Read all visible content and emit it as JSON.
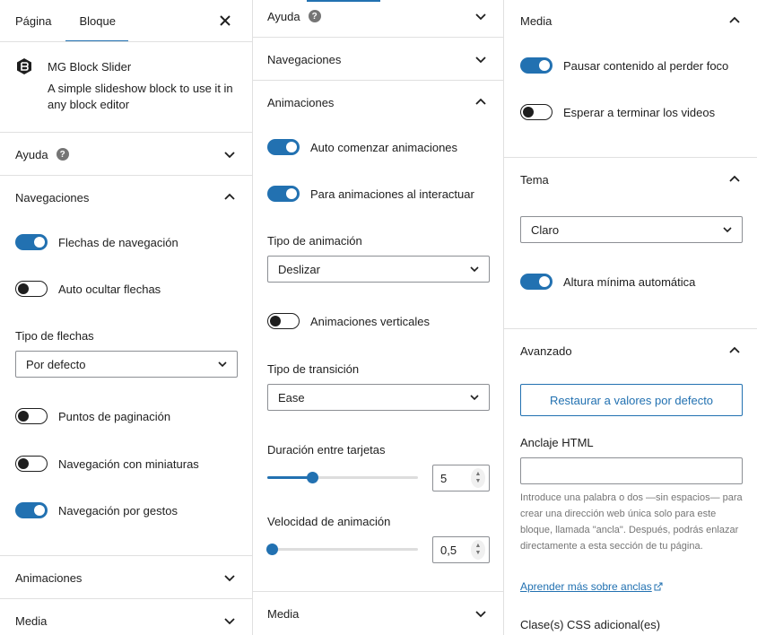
{
  "col1": {
    "tabs": [
      {
        "label": "Página"
      },
      {
        "label": "Bloque"
      }
    ],
    "block": {
      "title": "MG Block Slider",
      "description": "A simple slideshow block to use it in any block editor"
    },
    "help": {
      "title": "Ayuda"
    },
    "nav": {
      "title": "Navegaciones",
      "toggles": [
        {
          "label": "Flechas de navegación",
          "on": true
        },
        {
          "label": "Auto ocultar flechas",
          "on": false
        }
      ],
      "arrow_type_label": "Tipo de flechas",
      "arrow_type_value": "Por defecto",
      "toggles2": [
        {
          "label": "Puntos de paginación",
          "on": false
        },
        {
          "label": "Navegación con miniaturas",
          "on": false
        },
        {
          "label": "Navegación por gestos",
          "on": true
        }
      ]
    },
    "animations": {
      "title": "Animaciones"
    },
    "media": {
      "title": "Media"
    }
  },
  "col2": {
    "help": {
      "title": "Ayuda"
    },
    "nav": {
      "title": "Navegaciones"
    },
    "animations": {
      "title": "Animaciones",
      "toggles": [
        {
          "label": "Auto comenzar animaciones",
          "on": true
        },
        {
          "label": "Para animaciones al interactuar",
          "on": true
        }
      ],
      "anim_type_label": "Tipo de animación",
      "anim_type_value": "Deslizar",
      "vertical_label": "Animaciones verticales",
      "vertical_on": false,
      "transition_label": "Tipo de transición",
      "transition_value": "Ease",
      "duration_label": "Duración entre tarjetas",
      "duration_value": "5",
      "duration_fraction": 0.3,
      "speed_label": "Velocidad de animación",
      "speed_value": "0,5",
      "speed_fraction": 0.03
    },
    "media": {
      "title": "Media"
    }
  },
  "col3": {
    "media": {
      "title": "Media",
      "toggles": [
        {
          "label": "Pausar contenido al perder foco",
          "on": true
        },
        {
          "label": "Esperar a terminar los videos",
          "on": false
        }
      ]
    },
    "theme": {
      "title": "Tema",
      "value": "Claro",
      "min_height_label": "Altura mínima automática",
      "min_height_on": true
    },
    "advanced": {
      "title": "Avanzado",
      "reset_label": "Restaurar a valores por defecto",
      "anchor_label": "Anclaje HTML",
      "anchor_value": "",
      "anchor_help": "Introduce una palabra o dos —sin espacios— para crear una dirección web única solo para este bloque, llamada \"ancla\". Después, podrás enlazar directamente a esta sección de tu página.",
      "learn_more": "Aprender más sobre anclas",
      "css_class_label": "Clase(s) CSS adicional(es)"
    }
  },
  "colors": {
    "accent": "#2271b1",
    "border": "#e0e0e0",
    "text": "#1e1e1e",
    "muted": "#757575"
  }
}
